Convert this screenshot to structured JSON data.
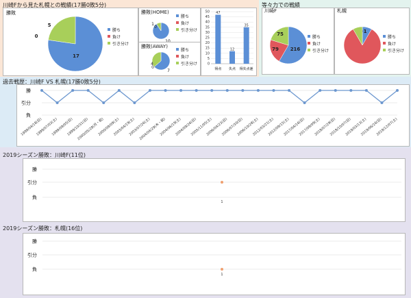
{
  "colors": {
    "win": "#5b8fd6",
    "loss": "#e0575c",
    "draw": "#a8cf5a",
    "line": "#6c97cf",
    "orange": "#f0a070"
  },
  "headers": {
    "overall": "川崎Fから見た札幌との戦績(17勝0敗5分)",
    "strength": "等々力での戦績",
    "history": "過去戦歴：川崎F VS 札幌(17勝0敗5分)",
    "season_kawasaki": "2019シーズン勝敗：川崎F(11位)",
    "season_sapporo": "2019シーズン勝敗：札幌(16位)"
  },
  "legend_labels": [
    "勝ち",
    "負け",
    "引き分け"
  ],
  "chart_data": [
    {
      "id": "overall",
      "type": "pie",
      "title": "勝敗",
      "labels": [
        "勝ち",
        "負け",
        "引き分け"
      ],
      "values": [
        17,
        0,
        5
      ]
    },
    {
      "id": "home",
      "type": "pie",
      "title": "勝敗(HOME)",
      "labels": [
        "勝ち",
        "負け",
        "引き分け"
      ],
      "values": [
        10,
        0,
        1
      ]
    },
    {
      "id": "away",
      "type": "pie",
      "title": "勝敗(AWAY)",
      "labels": [
        "勝ち",
        "負け",
        "引き分け"
      ],
      "values": [
        7,
        0,
        4
      ]
    },
    {
      "id": "bars",
      "type": "bar",
      "categories": [
        "得点",
        "失点",
        "得失点差"
      ],
      "values": [
        47,
        12,
        35
      ],
      "ylim": [
        0,
        50
      ],
      "yticks": [
        0,
        5,
        10,
        15,
        20,
        25,
        30,
        35,
        40,
        45,
        50
      ]
    },
    {
      "id": "todoroki_kawasaki",
      "type": "pie",
      "title": "川崎F",
      "labels": [
        "勝ち",
        "負け",
        "引き分け"
      ],
      "values": [
        216,
        79,
        75
      ]
    },
    {
      "id": "todoroki_sapporo",
      "type": "pie",
      "title": "札幌",
      "labels": [
        "勝ち",
        "負け",
        "引き分け"
      ],
      "values": [
        1,
        10,
        1
      ]
    },
    {
      "id": "history",
      "type": "line",
      "ylabels": [
        "勝",
        "引分",
        "負"
      ],
      "x": [
        "1999/04/18(日)",
        "1999/07/03(土)",
        "1999/09/05(日)",
        "1999/10/31(日)",
        "2000/05/28(月・祝)",
        "2000/09/09(土)",
        "2003/04/19(土)",
        "2003/07/26(土)",
        "2004/04/29(木・祝)",
        "2004/06/19(土)",
        "2004/09/26(日)",
        "2005/11/05(土)",
        "2006/04/23(日)",
        "2006/07/30(日)",
        "2006/10/28(土)",
        "2012/03/21(土)",
        "2012/09/15(土)",
        "2017/04/16(日)",
        "2017/09/09(土)",
        "2018/07/29(日)",
        "2018/10/07(日)",
        "2019/03/13(土)",
        "2019/06/16(日)",
        "2019/12/07(土)"
      ],
      "values": [
        1,
        0,
        1,
        1,
        0,
        1,
        0,
        1,
        1,
        1,
        1,
        1,
        1,
        1,
        1,
        1,
        1,
        0,
        1,
        1,
        1,
        1,
        0,
        1
      ]
    },
    {
      "id": "season_kawasaki",
      "type": "line",
      "ylabels": [
        "勝",
        "引分",
        "負"
      ],
      "x": [
        "1"
      ],
      "values": [
        0
      ]
    },
    {
      "id": "season_sapporo",
      "type": "line",
      "ylabels": [
        "勝",
        "引分",
        "負"
      ],
      "x": [
        "1"
      ],
      "values": [
        -1
      ]
    }
  ]
}
